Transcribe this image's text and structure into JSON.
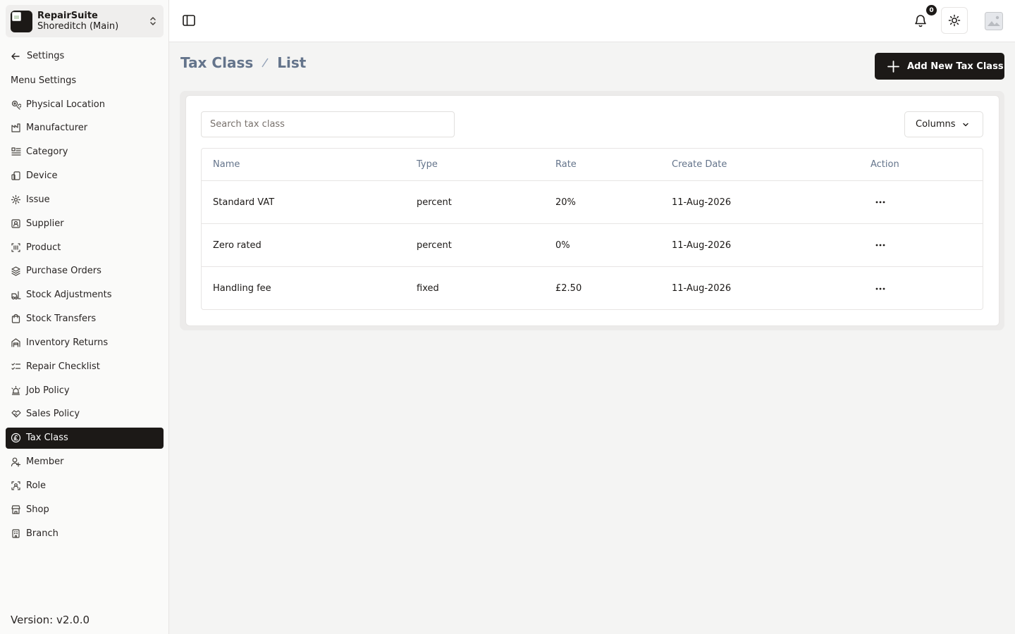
{
  "app": {
    "brand_name": "RepairSuite",
    "branch_name": "Shoreditch (Main)",
    "back_label": "Settings",
    "menu_title": "Menu Settings",
    "version": "Version: v2.0.0"
  },
  "sidebar": {
    "items": [
      {
        "label": "Physical Location",
        "icon": "location-icon"
      },
      {
        "label": "Manufacturer",
        "icon": "factory-icon"
      },
      {
        "label": "Category",
        "icon": "category-icon"
      },
      {
        "label": "Device",
        "icon": "device-icon"
      },
      {
        "label": "Issue",
        "icon": "settings-icon"
      },
      {
        "label": "Supplier",
        "icon": "contact-card-icon"
      },
      {
        "label": "Product",
        "icon": "barcode-icon"
      },
      {
        "label": "Purchase Orders",
        "icon": "layers-icon"
      },
      {
        "label": "Stock Adjustments",
        "icon": "forklift-icon"
      },
      {
        "label": "Stock Transfers",
        "icon": "shopping-bag-icon"
      },
      {
        "label": "Inventory Returns",
        "icon": "warehouse-icon"
      },
      {
        "label": "Repair Checklist",
        "icon": "checklist-icon"
      },
      {
        "label": "Job Policy",
        "icon": "siren-icon"
      },
      {
        "label": "Sales Policy",
        "icon": "handshake-icon"
      },
      {
        "label": "Tax Class",
        "icon": "pound-coin-icon",
        "active": true
      },
      {
        "label": "Member",
        "icon": "user-icon"
      },
      {
        "label": "Role",
        "icon": "user-scan-icon"
      },
      {
        "label": "Shop",
        "icon": "store-icon"
      },
      {
        "label": "Branch",
        "icon": "building-icon"
      }
    ]
  },
  "header": {
    "notification_count": "0"
  },
  "page": {
    "breadcrumb_section": "Tax Class",
    "breadcrumb_page": "List",
    "add_button_label": "Add New Tax Class"
  },
  "search": {
    "placeholder": "Search tax class",
    "value": ""
  },
  "columns_button_label": "Columns",
  "table": {
    "headers": [
      "Name",
      "Type",
      "Rate",
      "Create Date",
      "Action"
    ],
    "rows": [
      {
        "name": "Standard VAT",
        "type": "percent",
        "rate": "20%",
        "create_date": "11-Aug-2026"
      },
      {
        "name": "Zero rated",
        "type": "percent",
        "rate": "0%",
        "create_date": "11-Aug-2026"
      },
      {
        "name": "Handling fee",
        "type": "fixed",
        "rate": "£2.50",
        "create_date": "11-Aug-2026"
      }
    ]
  },
  "colors": {
    "primary": "#1c1917",
    "muted_text": "#64748b",
    "background": "#f4f4f3"
  }
}
